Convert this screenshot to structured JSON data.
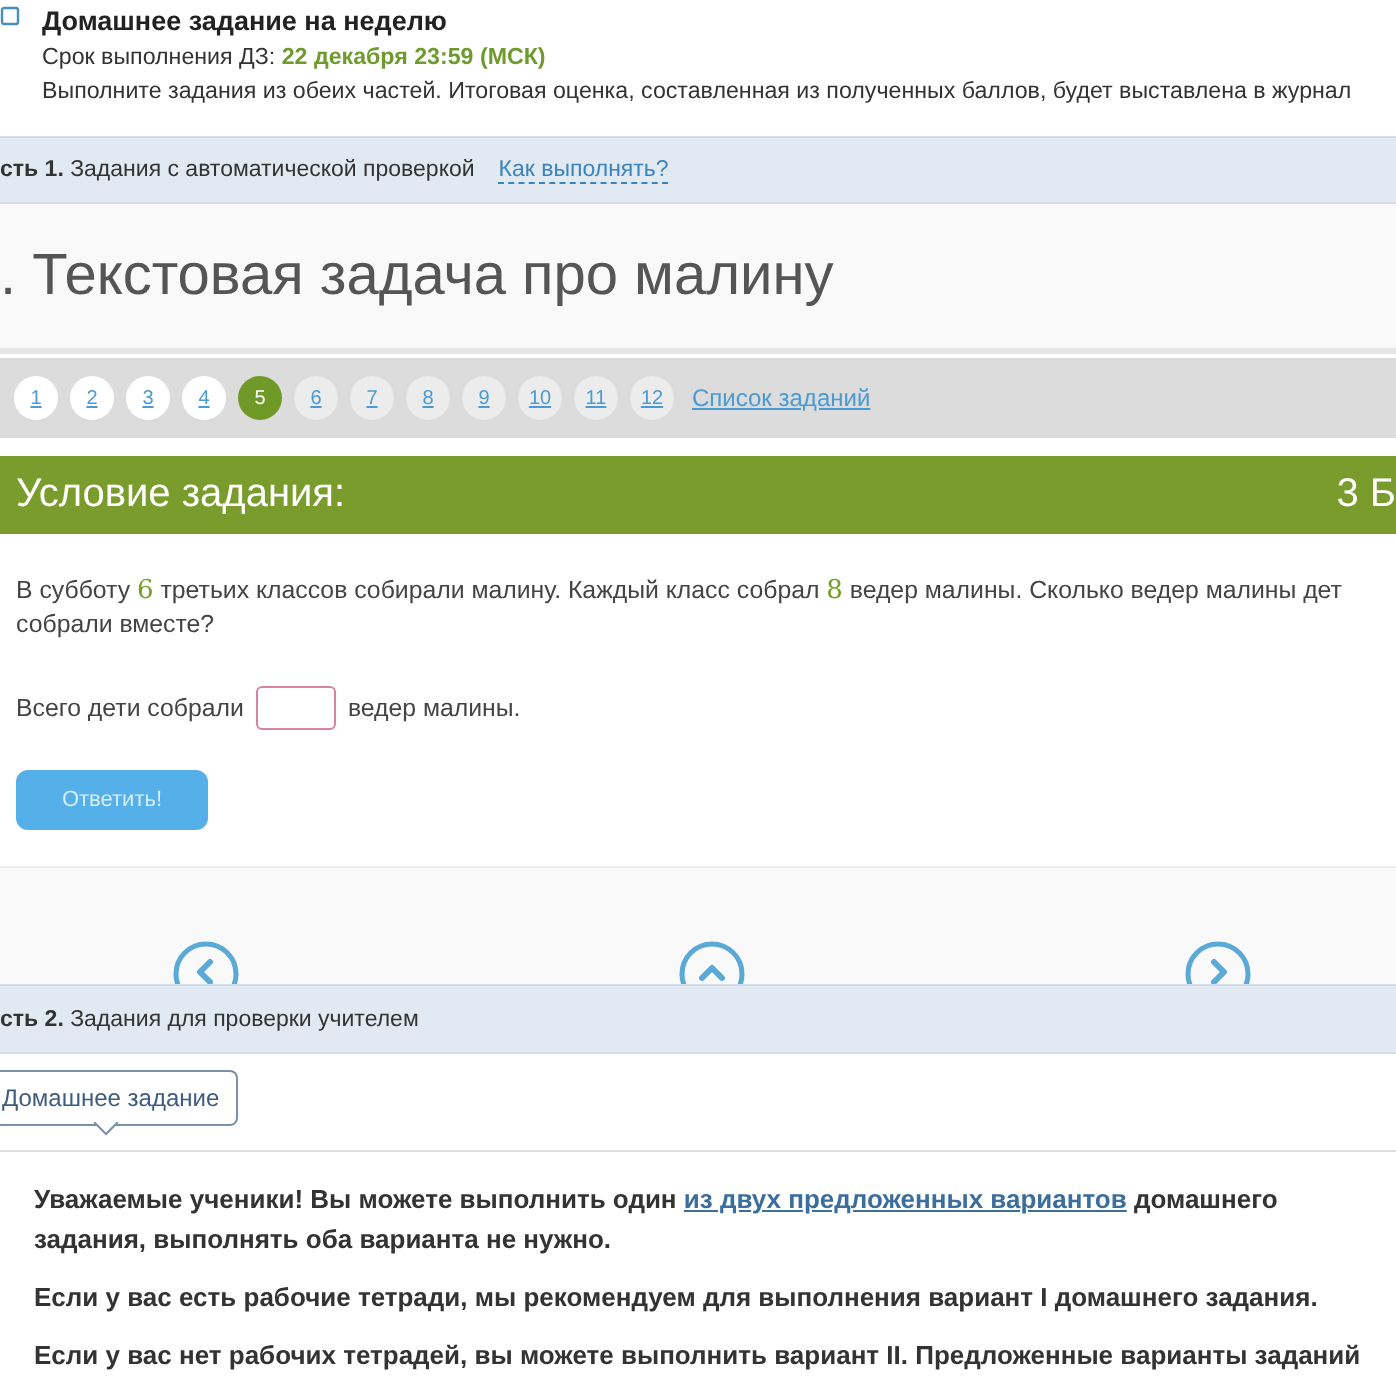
{
  "header": {
    "title": "Домашнее задание на неделю",
    "deadline_label": "Срок выполнения ДЗ:",
    "deadline_value": "22 декабря 23:59 (МСК)",
    "description": "Выполните задания из обеих частей. Итоговая оценка, составленная из полученных баллов, будет выставлена в журнал"
  },
  "part1": {
    "label": "сть 1.",
    "text": "Задания с автоматической проверкой",
    "link": "Как выполнять?"
  },
  "task_title": ". Текстовая задача про малину",
  "task_nav": [
    {
      "label": "1",
      "selected": false,
      "visited": true
    },
    {
      "label": "2",
      "selected": false,
      "visited": true
    },
    {
      "label": "3",
      "selected": false,
      "visited": true
    },
    {
      "label": "4",
      "selected": false,
      "visited": true
    },
    {
      "label": "5",
      "selected": true,
      "visited": true
    },
    {
      "label": "6",
      "selected": false,
      "visited": false
    },
    {
      "label": "7",
      "selected": false,
      "visited": false
    },
    {
      "label": "8",
      "selected": false,
      "visited": false
    },
    {
      "label": "9",
      "selected": false,
      "visited": false
    },
    {
      "label": "10",
      "selected": false,
      "visited": false
    },
    {
      "label": "11",
      "selected": false,
      "visited": false
    },
    {
      "label": "12",
      "selected": false,
      "visited": false
    }
  ],
  "task_list_link": "Список заданий",
  "condition": {
    "title": "Условие задания:",
    "points": "3 Б",
    "question": [
      {
        "kind": "plain",
        "text": "В субботу "
      },
      {
        "kind": "number",
        "text": "6"
      },
      {
        "kind": "plain",
        "text": " третьих классов собирали малину. Каждый класс собрал "
      },
      {
        "kind": "number",
        "text": "8"
      },
      {
        "kind": "plain",
        "text": " ведер малины. Сколько ведер малины дет собрали вместе?"
      }
    ],
    "answer_before": "Всего дети собрали",
    "answer_after": "ведер малины.",
    "submit": "Ответить!"
  },
  "part2": {
    "label": "сть 2.",
    "text": "Задания для проверки учителем"
  },
  "part2_tab": "Домашнее задание",
  "paragraphs": [
    {
      "before": "Уважаемые ученики! Вы можете выполнить один ",
      "link": "из двух предложенных вариантов",
      "after": " домашнего задания, выполнять оба варианта не нужно."
    },
    {
      "before": "Если у вас есть рабочие тетради, мы рекомендуем для выполнения вариант I домашнего задания."
    },
    {
      "before": "Если у вас нет рабочих тетрадей, вы можете выполнить вариант II. Предложенные варианты заданий"
    }
  ]
}
